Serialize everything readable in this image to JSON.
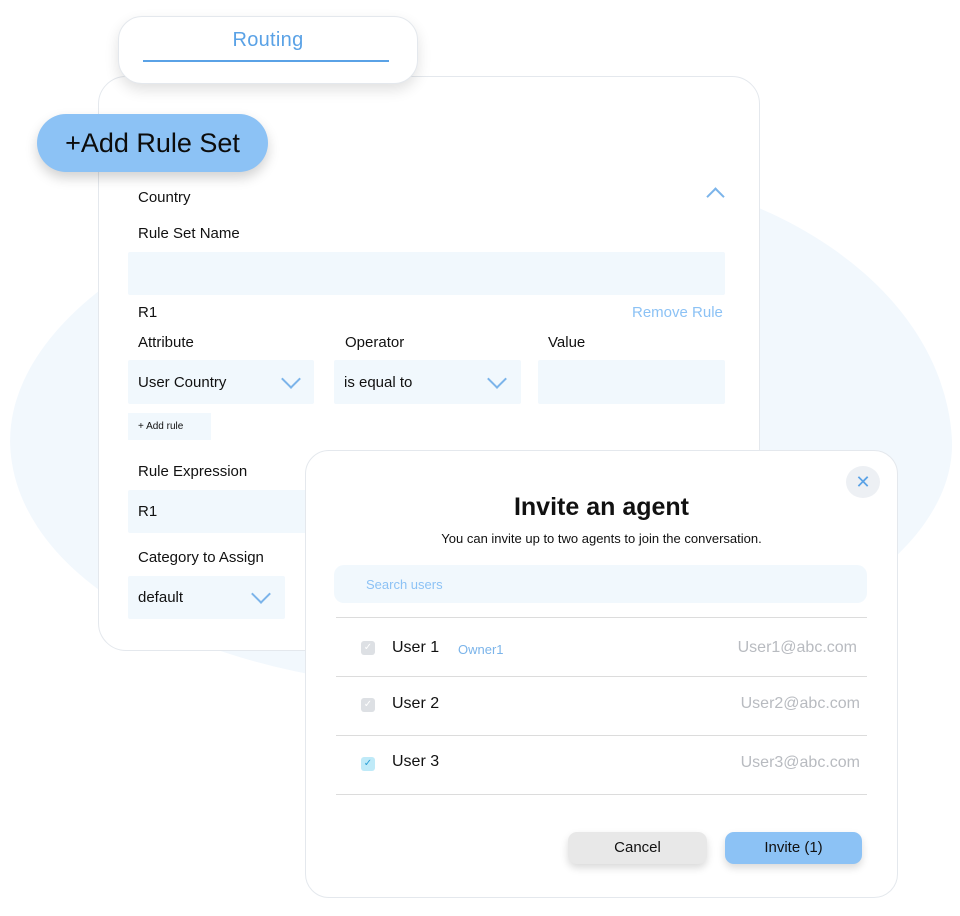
{
  "tab": {
    "label": "Routing"
  },
  "add_rule_set_label": "+Add Rule Set",
  "rule_set": {
    "section_label": "Country",
    "name_label": "Rule Set Name",
    "name_value": "",
    "rule_id": "R1",
    "remove_rule_label": "Remove Rule",
    "attribute_label": "Attribute",
    "operator_label": "Operator",
    "value_label": "Value",
    "attribute_value": "User Country",
    "operator_value": "is equal to",
    "value_value": "",
    "add_rule_label": "+   Add rule",
    "expression_label": "Rule Expression",
    "expression_value": "R1",
    "category_label": "Category to Assign",
    "category_value": "default"
  },
  "modal": {
    "title": "Invite an agent",
    "subtitle": "You can invite up to two agents to join the conversation.",
    "search_placeholder": "Search users",
    "close_icon": "close-icon",
    "users": [
      {
        "name": "User 1",
        "badge": "Owner1",
        "email": "User1@abc.com",
        "checked": false
      },
      {
        "name": "User 2",
        "badge": "",
        "email": "User2@abc.com",
        "checked": false
      },
      {
        "name": "User 3",
        "badge": "",
        "email": "User3@abc.com",
        "checked": true
      }
    ],
    "cancel_label": "Cancel",
    "invite_label": "Invite (1)"
  },
  "colors": {
    "accent": "#5aa2e6",
    "button_blue": "#8cc2f5",
    "field_bg": "#f1f8fd",
    "muted_text": "#b8bbc0"
  }
}
